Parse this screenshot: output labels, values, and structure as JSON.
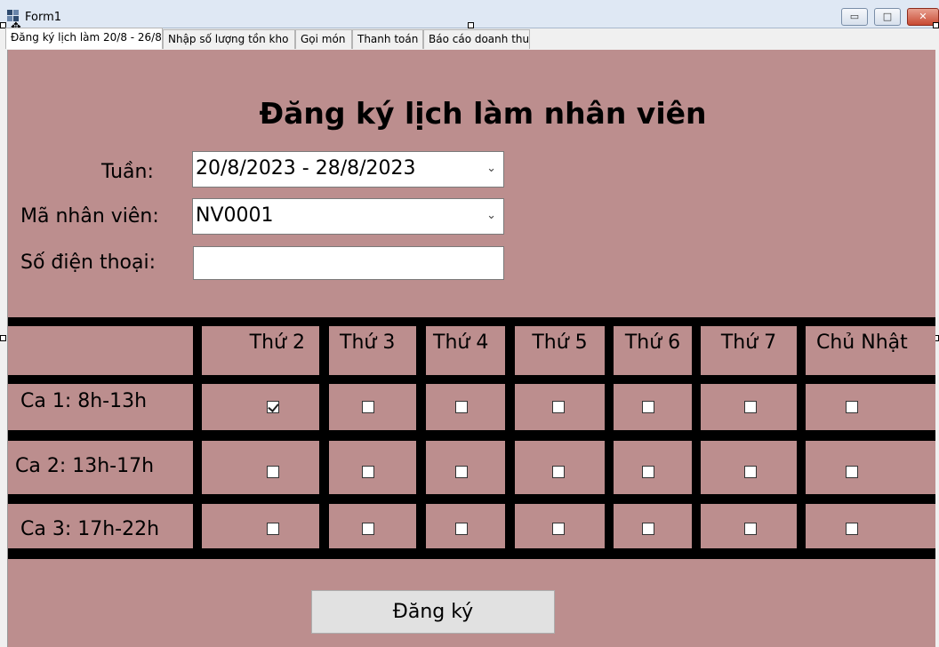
{
  "window": {
    "title": "Form1",
    "min_glyph": "▭",
    "max_glyph": "□",
    "close_glyph": "✕"
  },
  "tabs": [
    {
      "label": "Đăng ký lịch làm 20/8 - 26/8",
      "active": true
    },
    {
      "label": "Nhập số lượng tồn kho",
      "active": false
    },
    {
      "label": "Gọi món",
      "active": false
    },
    {
      "label": "Thanh toán",
      "active": false
    },
    {
      "label": "Báo cáo doanh thu",
      "active": false
    }
  ],
  "form": {
    "heading": "Đăng ký lịch làm nhân viên",
    "week_label": "Tuần:",
    "week_value": "20/8/2023 - 28/8/2023",
    "employee_label": "Mã nhân viên:",
    "employee_value": "NV0001",
    "phone_label": "Số điện thoại:",
    "phone_value": ""
  },
  "schedule": {
    "days": [
      "Thứ 2",
      "Thứ 3",
      "Thứ 4",
      "Thứ 5",
      "Thứ 6",
      "Thứ 7",
      "Chủ Nhật"
    ],
    "shifts": [
      {
        "label": "Ca 1: 8h-13h",
        "checked": [
          true,
          false,
          false,
          false,
          false,
          false,
          false
        ]
      },
      {
        "label": "Ca 2: 13h-17h",
        "checked": [
          false,
          false,
          false,
          false,
          false,
          false,
          false
        ]
      },
      {
        "label": "Ca 3: 17h-22h",
        "checked": [
          false,
          false,
          false,
          false,
          false,
          false,
          false
        ]
      }
    ]
  },
  "submit_label": "Đăng ký",
  "colors": {
    "page_bg": "#bc8e8e",
    "grid_lines": "#000000",
    "button_bg": "#e1e1e1"
  }
}
